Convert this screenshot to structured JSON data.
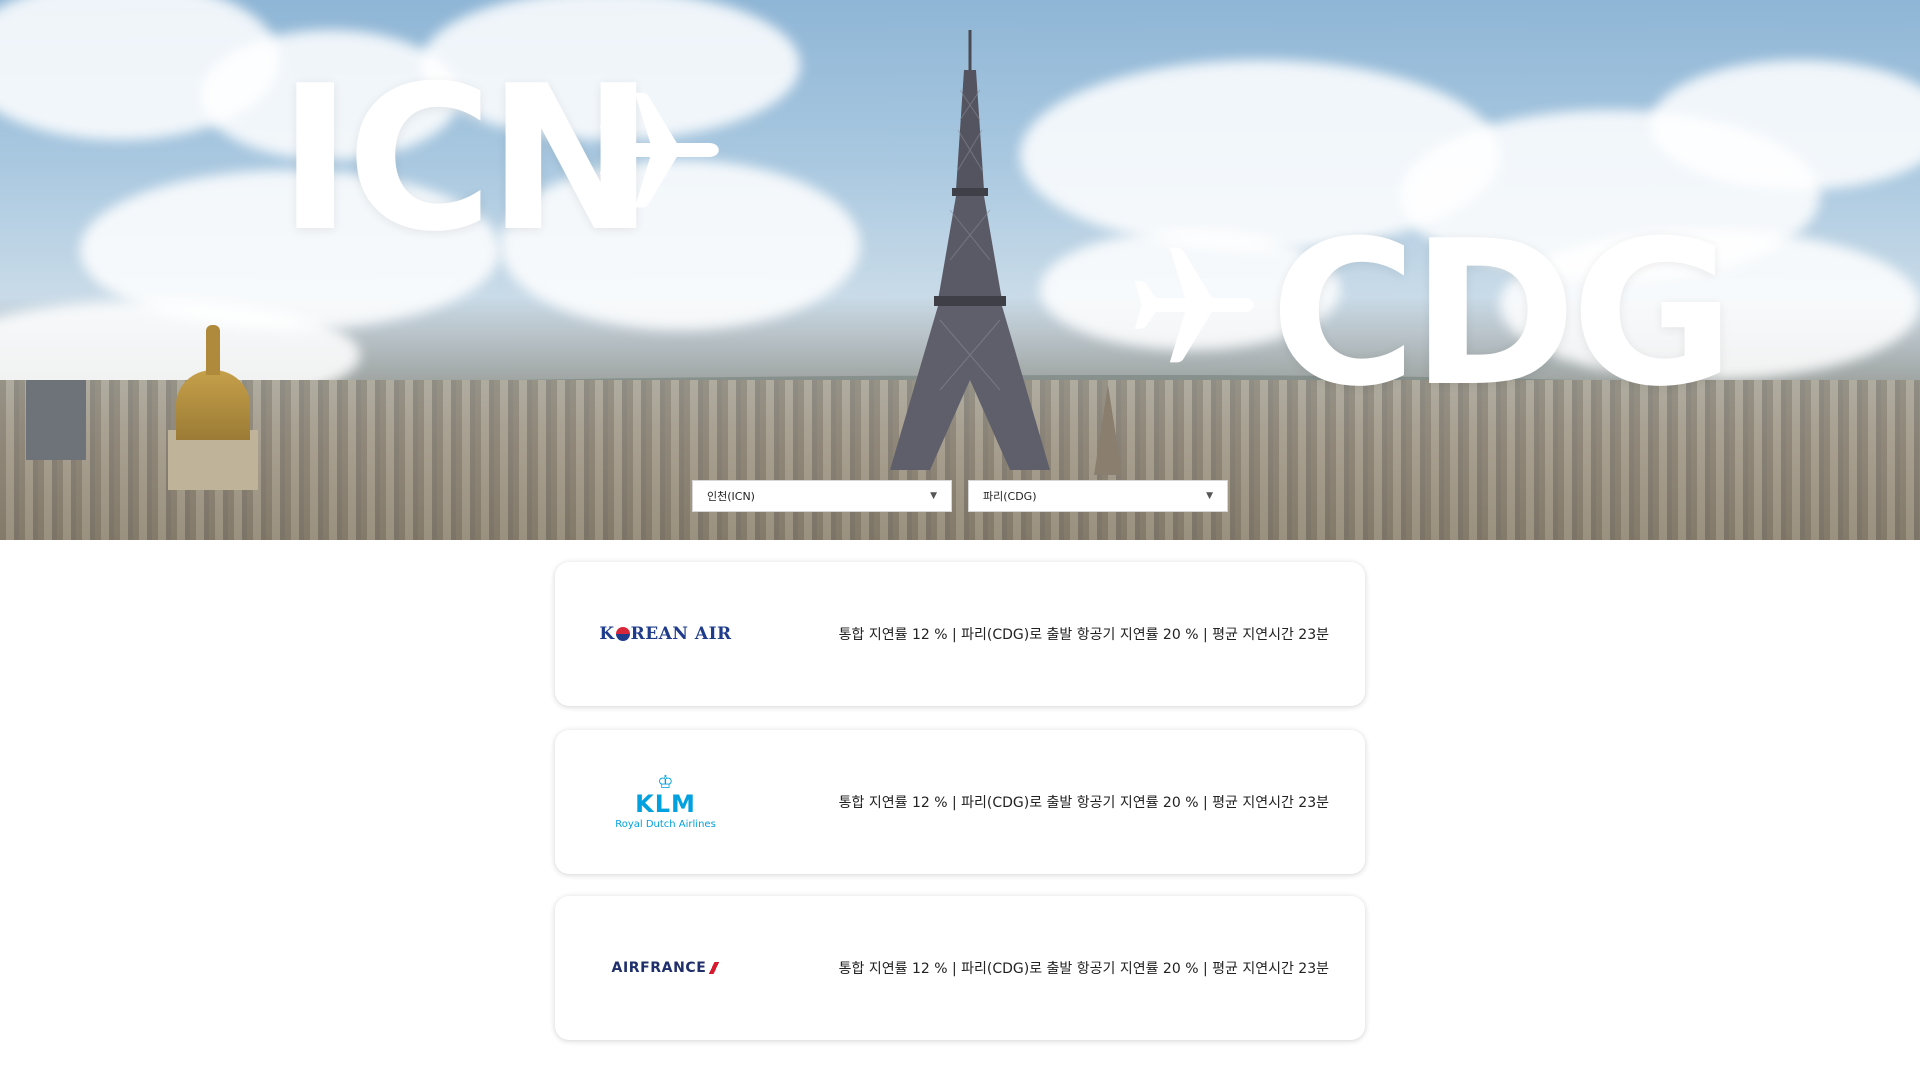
{
  "hero": {
    "origin_code": "ICN",
    "destination_code": "CDG",
    "origin_plane_icon": "airplane-icon",
    "destination_plane_icon": "airplane-icon"
  },
  "selects": {
    "origin": {
      "value": "인천(ICN)",
      "caret_icon": "chevron-down-icon"
    },
    "destination": {
      "value": "파리(CDG)",
      "caret_icon": "chevron-down-icon"
    }
  },
  "airlines": [
    {
      "logo_text": "KOREAN AIR",
      "stats": "통합 지연률 12 % | 파리(CDG)로 출발 항공기 지연률 20 % | 평균 지연시간 23분"
    },
    {
      "logo_text": "KLM",
      "logo_subtext": "Royal Dutch Airlines",
      "stats": "통합 지연률 12 % | 파리(CDG)로 출발 항공기 지연률 20 % | 평균 지연시간 23분"
    },
    {
      "logo_text": "AIRFRANCE",
      "stats": "통합 지연률 12 % | 파리(CDG)로 출발 항공기 지연률 20 % | 평균 지연시간 23분"
    }
  ],
  "colors": {
    "korean_air_blue": "#1f3c8c",
    "korean_air_red": "#d8263b",
    "klm_blue": "#00a1de",
    "air_france_navy": "#1f2f6b",
    "air_france_red": "#d7192d"
  },
  "caret_glyph": "▼"
}
